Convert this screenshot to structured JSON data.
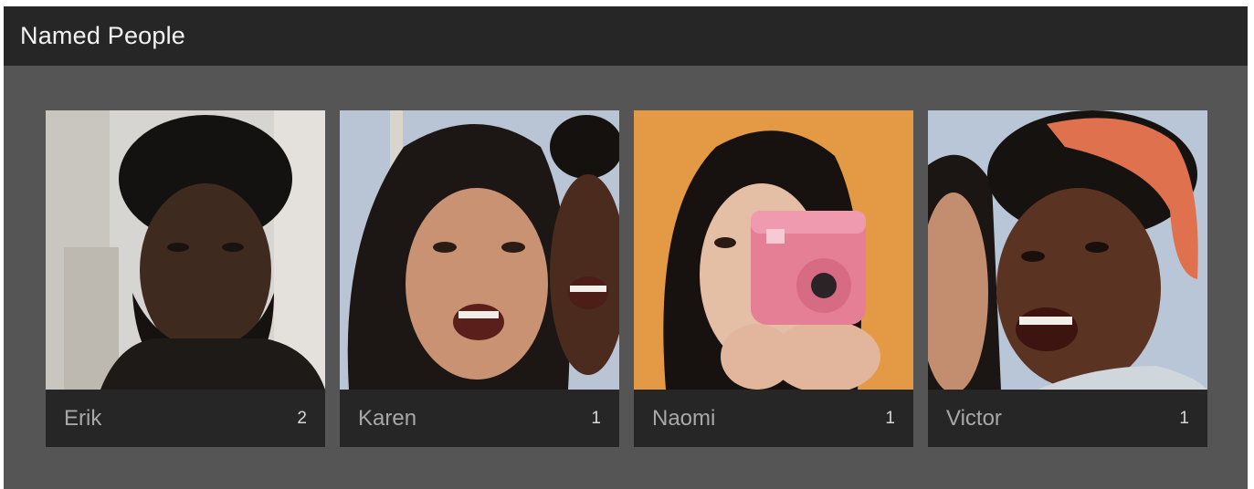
{
  "header": {
    "title": "Named People"
  },
  "people": [
    {
      "name": "Erik",
      "count": "2"
    },
    {
      "name": "Karen",
      "count": "1"
    },
    {
      "name": "Naomi",
      "count": "1"
    },
    {
      "name": "Victor",
      "count": "1"
    }
  ],
  "colors": {
    "panel": "#555555",
    "header": "#262626",
    "card_footer": "#262626",
    "name_text": "#a8a8a8"
  }
}
